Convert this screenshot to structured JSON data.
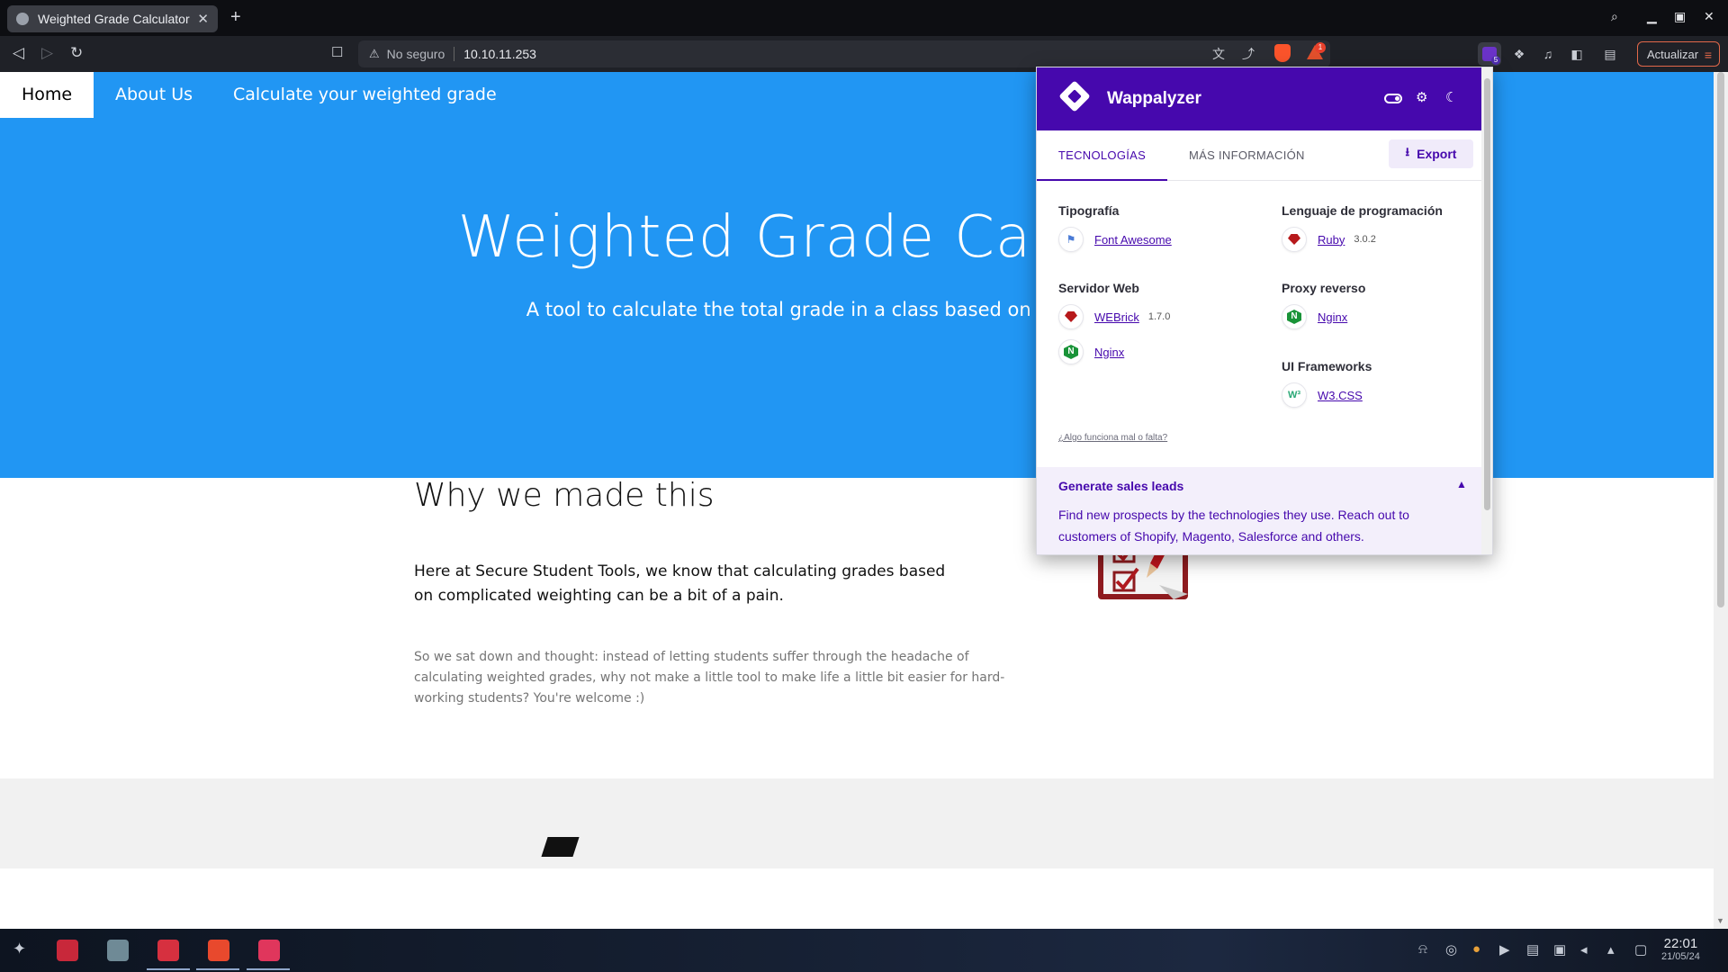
{
  "browser": {
    "tab_title": "Weighted Grade Calculator",
    "tab_close": "✕",
    "new_tab": "+",
    "security_label": "No seguro",
    "url": "10.10.11.253",
    "update_label": "Actualizar",
    "rewards_badge": "1",
    "extension_count": "5"
  },
  "site": {
    "nav": [
      "Home",
      "About Us",
      "Calculate your weighted grade"
    ],
    "hero_title": "Weighted Grade Calculator",
    "hero_subtitle": "A tool to calculate the total grade in a class based on category scores",
    "section_title": "Why we made this",
    "lead": "Here at Secure Student Tools, we know that calculating grades based on complicated weighting can be a bit of a pain.",
    "body": "So we sat down and thought: instead of letting students suffer through the headache of calculating weighted grades, why not make a little tool to make life a little bit easier for hard-working students? You're welcome :)"
  },
  "wappalyzer": {
    "brand": "Wappalyzer",
    "tabs": [
      "TECNOLOGÍAS",
      "MÁS INFORMACIÓN"
    ],
    "export_label": "Export",
    "categories": {
      "typography": {
        "title": "Tipografía",
        "techs": [
          {
            "name": "Font Awesome",
            "version": ""
          }
        ]
      },
      "language": {
        "title": "Lenguaje de programación",
        "techs": [
          {
            "name": "Ruby",
            "version": "3.0.2"
          }
        ]
      },
      "webserver": {
        "title": "Servidor Web",
        "techs": [
          {
            "name": "WEBrick",
            "version": "1.7.0"
          },
          {
            "name": "Nginx",
            "version": ""
          }
        ]
      },
      "proxy": {
        "title": "Proxy reverso",
        "techs": [
          {
            "name": "Nginx",
            "version": ""
          }
        ]
      },
      "ui": {
        "title": "UI Frameworks",
        "techs": [
          {
            "name": "W3.CSS",
            "version": ""
          }
        ]
      }
    },
    "feedback": "¿Algo funciona mal o falta?",
    "leads_title": "Generate sales leads",
    "leads_text": "Find new prospects by the technologies they use. Reach out to customers of Shopify, Magento, Salesforce and others."
  },
  "taskbar": {
    "time": "22:01",
    "date": "21/05/24"
  },
  "colors": {
    "site_primary": "#2196f3",
    "wappalyzer_purple": "#4608ad",
    "brave_orange": "#fb542b"
  }
}
